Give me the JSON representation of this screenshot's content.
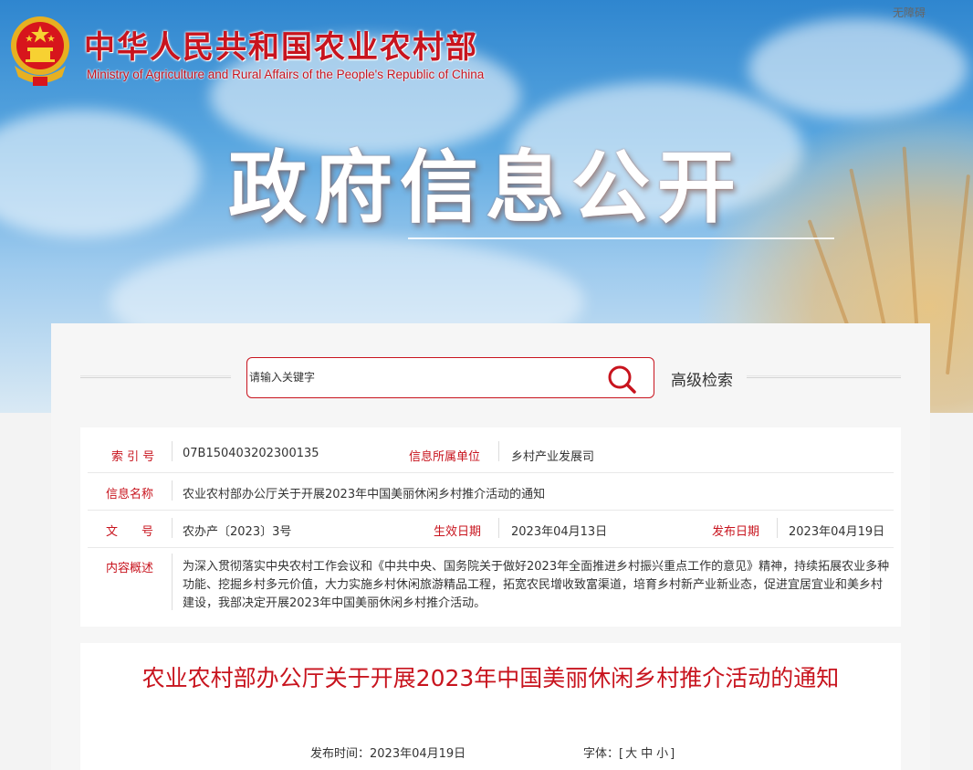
{
  "header": {
    "site_title_cn": "中华人民共和国农业农村部",
    "site_title_en": "Ministry of Agriculture and Rural Affairs of the People's Republic of China",
    "accessibility": "无障碍",
    "hero_title": "政府信息公开"
  },
  "search": {
    "placeholder": "请输入关键字",
    "advanced_label": "高级检索"
  },
  "meta": {
    "index_label": "索 引 号",
    "index_value": "07B150403202300135",
    "unit_label": "信息所属单位",
    "unit_value": "乡村产业发展司",
    "name_label": "信息名称",
    "name_value": "农业农村部办公厅关于开展2023年中国美丽休闲乡村推介活动的通知",
    "doc_no_label": "文　　号",
    "doc_no_value": "农办产〔2023〕3号",
    "effective_label": "生效日期",
    "effective_value": "2023年04月13日",
    "publish_label": "发布日期",
    "publish_value": "2023年04月19日",
    "summary_label": "内容概述",
    "summary_value": "为深入贯彻落实中央农村工作会议和《中共中央、国务院关于做好2023年全面推进乡村振兴重点工作的意见》精神，持续拓展农业多种功能、挖掘乡村多元价值，大力实施乡村休闲旅游精品工程，拓宽农民增收致富渠道，培育乡村新产业新业态，促进宜居宜业和美乡村建设，我部决定开展2023年中国美丽休闲乡村推介活动。"
  },
  "article": {
    "title": "农业农村部办公厅关于开展2023年中国美丽休闲乡村推介活动的通知",
    "publish_time": "发布时间：2023年04月19日",
    "font_label": "字体：[",
    "font_large": "大",
    "font_medium": "中",
    "font_small": "小",
    "font_close": "]"
  },
  "colors": {
    "brand_red": "#c8141e",
    "sky_blue": "#2f86cf"
  }
}
